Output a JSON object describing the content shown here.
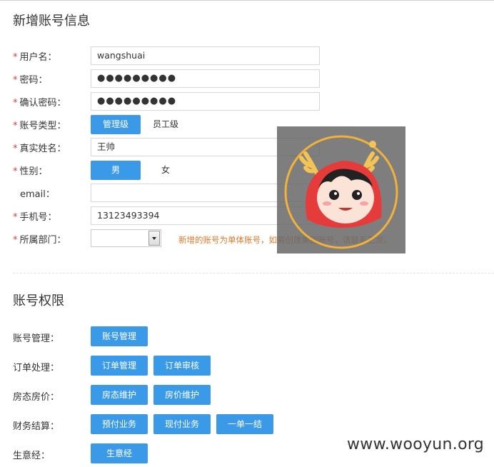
{
  "account_info": {
    "title": "新增账号信息",
    "required_mark": "*",
    "username": {
      "label": "用户名：",
      "value": "wangshuai"
    },
    "password": {
      "label": "密码：",
      "value": "●●●●●●●●●"
    },
    "confirm_password": {
      "label": "确认密码：",
      "value": "●●●●●●●●●"
    },
    "account_type": {
      "label": "账号类型：",
      "options": [
        "管理级",
        "员工级"
      ],
      "selected": "管理级"
    },
    "real_name": {
      "label": "真实姓名：",
      "value": "王帅"
    },
    "gender": {
      "label": "性别：",
      "options": [
        "男",
        "女"
      ],
      "selected": "男"
    },
    "email": {
      "label": "email：",
      "value": ""
    },
    "phone": {
      "label": "手机号：",
      "value": "13123493394"
    },
    "department": {
      "label": "所属部门：",
      "value": "",
      "note": "新增的账号为单体账号，如需创建集团账号，请联系艺龙。"
    }
  },
  "permissions": {
    "title": "账号权限",
    "groups": [
      {
        "label": "账号管理：",
        "buttons": [
          "账号管理"
        ]
      },
      {
        "label": "订单处理：",
        "buttons": [
          "订单管理",
          "订单审核"
        ]
      },
      {
        "label": "房态房价：",
        "buttons": [
          "房态维护",
          "房价维护"
        ]
      },
      {
        "label": "财务结算：",
        "buttons": [
          "预付业务",
          "现付业务",
          "一单一结"
        ]
      },
      {
        "label": "生意经：",
        "buttons": [
          "生意经"
        ]
      }
    ]
  },
  "watermark": "www.wooyun.org",
  "colors": {
    "accent": "#3a9ae7",
    "required": "#e4393c",
    "note": "#e07a2b"
  }
}
